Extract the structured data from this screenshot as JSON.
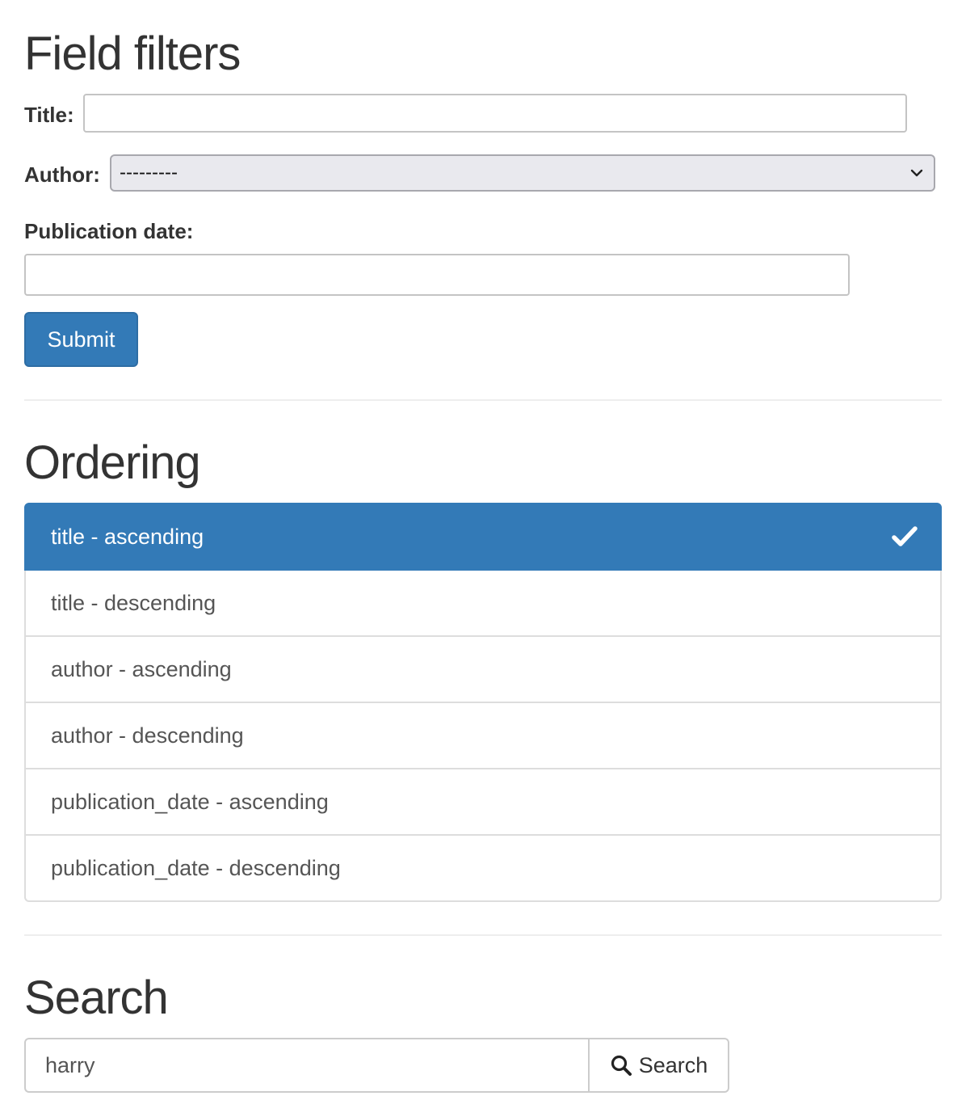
{
  "field_filters": {
    "heading": "Field filters",
    "title_label": "Title:",
    "title_value": "",
    "author_label": "Author:",
    "author_selected": "---------",
    "publication_date_label": "Publication date:",
    "publication_date_value": "",
    "submit_label": "Submit"
  },
  "ordering": {
    "heading": "Ordering",
    "items": [
      {
        "label": "title - ascending",
        "active": true
      },
      {
        "label": "title - descending",
        "active": false
      },
      {
        "label": "author - ascending",
        "active": false
      },
      {
        "label": "author - descending",
        "active": false
      },
      {
        "label": "publication_date - ascending",
        "active": false
      },
      {
        "label": "publication_date - descending",
        "active": false
      }
    ],
    "active_icon": "checkmark-icon"
  },
  "search": {
    "heading": "Search",
    "query_value": "harry",
    "button_label": "Search",
    "button_icon": "search-icon"
  },
  "colors": {
    "primary": "#337ab7",
    "text": "#333333",
    "border": "#dddddd"
  }
}
